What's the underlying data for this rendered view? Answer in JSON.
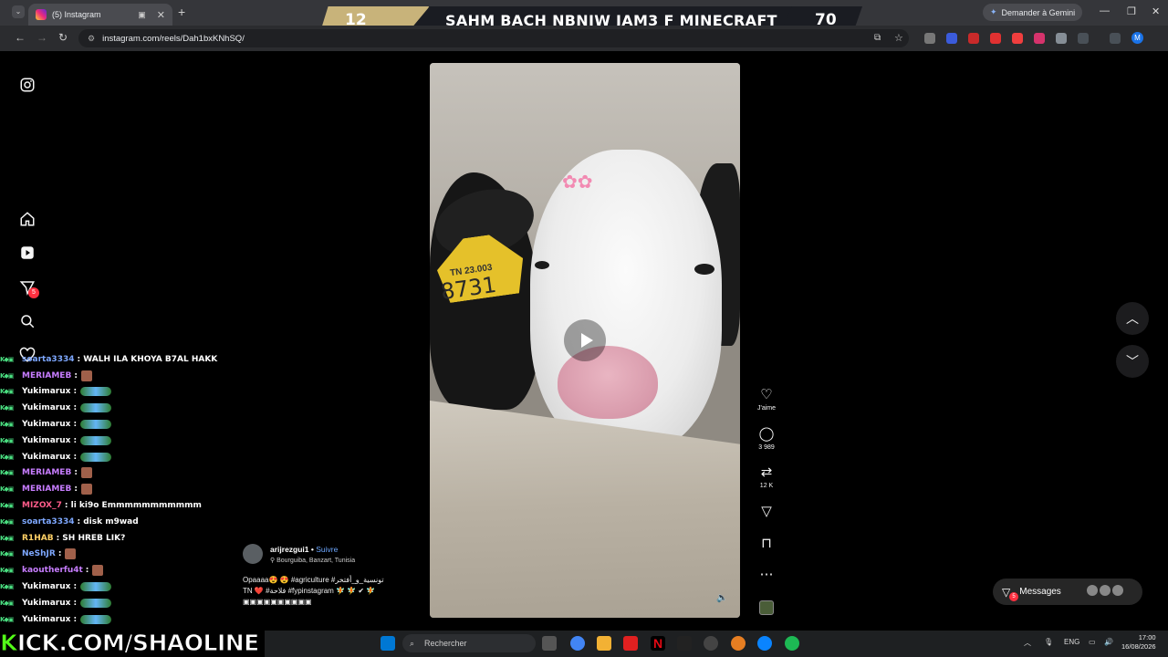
{
  "browser": {
    "tab_title": "(5) Instagram",
    "new_tab": "+",
    "url": "instagram.com/reels/Dah1bxKNhSQ/",
    "gemini_label": "Demander à Gemini",
    "profile_initial": "M"
  },
  "stream_overlay": {
    "left_number": "12",
    "title": "SAHM BACH NBNIW JAM3 F MINECRAFT",
    "right_number": "70",
    "channel": "KICK.COM/SHAOLINE"
  },
  "sidebar": {
    "notifications_badge": "5"
  },
  "reel": {
    "tag_text": "TN 23.003",
    "tag_number": "8731",
    "flowers": "✿✿",
    "author": "arijrezgui1",
    "follow_label": "Suivre",
    "location": "Bourguiba, Banzart, Tunisia",
    "caption_line1": "Opaaaa😍 😍 #agriculture #تونسية_و_أفتخر",
    "caption_line2": "TN ❤️ #فلاحة #fypinstagram 🧚 🧚 ✔ 🧚",
    "caption_line3": "▣▣▣▣▣▣▣▣▣▣"
  },
  "actions": {
    "like_label": "J'aime",
    "comments_count": "3 989",
    "reposts_count": "12 K"
  },
  "messages": {
    "label": "Messages",
    "badge": "5"
  },
  "chat": [
    {
      "user": "soarta3334",
      "color": "#7ea8ff",
      "msg": "WALH ILA KHOYA B7AL HAKK",
      "emote": "none"
    },
    {
      "user": "MERIAMEB",
      "color": "#c77dff",
      "msg": "",
      "emote": "face"
    },
    {
      "user": "Yukimarux",
      "color": "#ffffff",
      "msg": "",
      "emote": "wide"
    },
    {
      "user": "Yukimarux",
      "color": "#ffffff",
      "msg": "",
      "emote": "wide"
    },
    {
      "user": "Yukimarux",
      "color": "#ffffff",
      "msg": "",
      "emote": "wide"
    },
    {
      "user": "Yukimarux",
      "color": "#ffffff",
      "msg": "",
      "emote": "wide"
    },
    {
      "user": "Yukimarux",
      "color": "#ffffff",
      "msg": "",
      "emote": "wide"
    },
    {
      "user": "MERIAMEB",
      "color": "#c77dff",
      "msg": "",
      "emote": "face"
    },
    {
      "user": "MERIAMEB",
      "color": "#c77dff",
      "msg": "",
      "emote": "face"
    },
    {
      "user": "MIZOX_7",
      "color": "#ff5c8a",
      "msg": "li ki9o Emmmmmmmmmmm",
      "emote": "none"
    },
    {
      "user": "soarta3334",
      "color": "#7ea8ff",
      "msg": "disk m9wad",
      "emote": "none"
    },
    {
      "user": "R1HAB",
      "color": "#ffd166",
      "msg": "SH HREB LIK?",
      "emote": "none"
    },
    {
      "user": "NeShJR",
      "color": "#7ea8ff",
      "msg": "",
      "emote": "face"
    },
    {
      "user": "kaoutherfu4t",
      "color": "#c77dff",
      "msg": "",
      "emote": "face"
    },
    {
      "user": "Yukimarux",
      "color": "#ffffff",
      "msg": "",
      "emote": "wide"
    },
    {
      "user": "Yukimarux",
      "color": "#ffffff",
      "msg": "",
      "emote": "wide"
    },
    {
      "user": "Yukimarux",
      "color": "#ffffff",
      "msg": "",
      "emote": "wide"
    }
  ],
  "taskbar": {
    "search_placeholder": "Rechercher",
    "lang": "ENG",
    "time": "17:00",
    "date": "16/08/2026"
  },
  "colors": {
    "instagram_badge": "#ff3040",
    "kick_green": "#53fc18",
    "link_blue": "#6ea8ff"
  }
}
